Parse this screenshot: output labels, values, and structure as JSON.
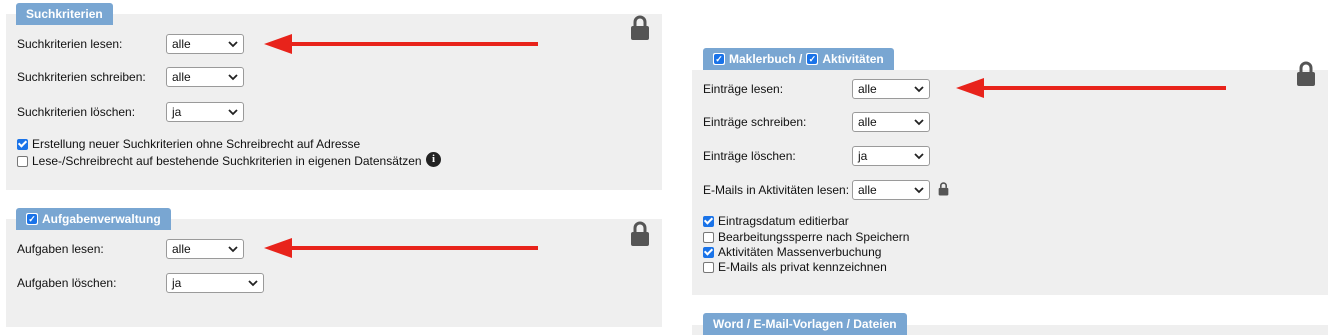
{
  "left_panel_1": {
    "tab_label": "Suchkriterien",
    "rows": [
      {
        "label": "Suchkriterien lesen:",
        "value": "alle"
      },
      {
        "label": "Suchkriterien schreiben:",
        "value": "alle"
      },
      {
        "label": "Suchkriterien löschen:",
        "value": "ja"
      }
    ],
    "checkboxes": [
      {
        "label": "Erstellung neuer Suchkriterien ohne Schreibrecht auf Adresse",
        "checked": true
      },
      {
        "label": "Lese-/Schreibrecht auf bestehende Suchkriterien in eigenen Datensätzen",
        "checked": false
      }
    ],
    "info_icon": "i"
  },
  "left_panel_2": {
    "tab_label": "Aufgabenverwaltung",
    "tab_checked": true,
    "rows": [
      {
        "label": "Aufgaben lesen:",
        "value": "alle"
      },
      {
        "label": "Aufgaben löschen:",
        "value": "ja"
      }
    ]
  },
  "right_panel_1": {
    "tab_label_1": "Maklerbuch /",
    "tab_label_2": "Aktivitäten",
    "rows": [
      {
        "label": "Einträge lesen:",
        "value": "alle"
      },
      {
        "label": "Einträge schreiben:",
        "value": "alle"
      },
      {
        "label": "Einträge löschen:",
        "value": "ja"
      },
      {
        "label": "E-Mails in Aktivitäten lesen:",
        "value": "alle"
      }
    ],
    "checkboxes": [
      {
        "label": "Eintragsdatum editierbar",
        "checked": true
      },
      {
        "label": "Bearbeitungssperre nach Speichern",
        "checked": false
      },
      {
        "label": "Aktivitäten Massenverbuchung",
        "checked": true
      },
      {
        "label": "E-Mails als privat kennzeichnen",
        "checked": false
      }
    ]
  },
  "right_panel_2": {
    "tab_label": "Word / E-Mail-Vorlagen / Dateien"
  },
  "colors": {
    "tab": "#79a6d2",
    "panel": "#efefef",
    "arrow": "#e8231b",
    "checkbox": "#1a73e8"
  },
  "icons": [
    "lock-icon",
    "info-icon",
    "arrow-annotation",
    "chevron-down-icon"
  ]
}
